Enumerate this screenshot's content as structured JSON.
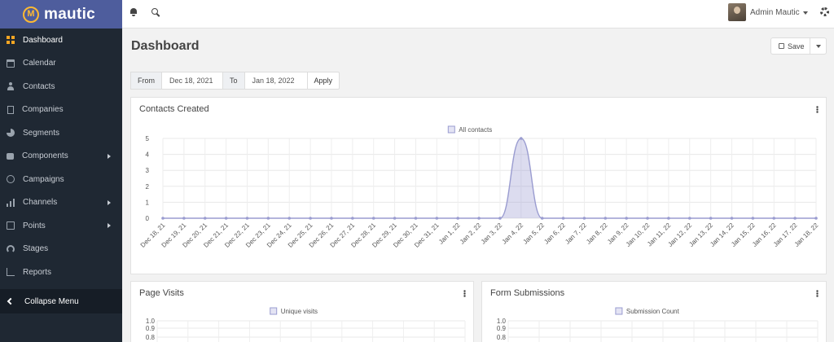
{
  "brand": {
    "name": "mautic",
    "logo_letter": "M"
  },
  "sidebar": {
    "items": [
      {
        "label": "Dashboard",
        "icon": "dashboard-icon",
        "active": true
      },
      {
        "label": "Calendar",
        "icon": "calendar-icon"
      },
      {
        "label": "Contacts",
        "icon": "user-icon"
      },
      {
        "label": "Companies",
        "icon": "building-icon"
      },
      {
        "label": "Segments",
        "icon": "pie-icon"
      },
      {
        "label": "Components",
        "icon": "puzzle-icon",
        "submenu": true
      },
      {
        "label": "Campaigns",
        "icon": "clock-icon"
      },
      {
        "label": "Channels",
        "icon": "signal-icon",
        "submenu": true
      },
      {
        "label": "Points",
        "icon": "calculator-icon",
        "submenu": true
      },
      {
        "label": "Stages",
        "icon": "gauge-icon"
      },
      {
        "label": "Reports",
        "icon": "line-chart-icon"
      }
    ],
    "collapse_label": "Collapse Menu"
  },
  "topbar": {
    "user_name": "Admin Mautic"
  },
  "page": {
    "title": "Dashboard",
    "save_label": "Save"
  },
  "date_range": {
    "from_label": "From",
    "from_value": "Dec 18, 2021",
    "to_label": "To",
    "to_value": "Jan 18, 2022",
    "apply_label": "Apply"
  },
  "colors": {
    "brand": "#4e5d9d",
    "sidebar": "#1f2833",
    "accent": "#f5a623",
    "series": "#9a9cd0"
  },
  "chart_data": [
    {
      "type": "area",
      "title": "Contacts Created",
      "categories": [
        "Dec 18, 21",
        "Dec 19, 21",
        "Dec 20, 21",
        "Dec 21, 21",
        "Dec 22, 21",
        "Dec 23, 21",
        "Dec 24, 21",
        "Dec 25, 21",
        "Dec 26, 21",
        "Dec 27, 21",
        "Dec 28, 21",
        "Dec 29, 21",
        "Dec 30, 21",
        "Dec 31, 21",
        "Jan 1, 22",
        "Jan 2, 22",
        "Jan 3, 22",
        "Jan 4, 22",
        "Jan 5, 22",
        "Jan 6, 22",
        "Jan 7, 22",
        "Jan 8, 22",
        "Jan 9, 22",
        "Jan 10, 22",
        "Jan 11, 22",
        "Jan 12, 22",
        "Jan 13, 22",
        "Jan 14, 22",
        "Jan 15, 22",
        "Jan 16, 22",
        "Jan 17, 22",
        "Jan 18, 22"
      ],
      "series": [
        {
          "name": "All contacts",
          "values": [
            0,
            0,
            0,
            0,
            0,
            0,
            0,
            0,
            0,
            0,
            0,
            0,
            0,
            0,
            0,
            0,
            0,
            5,
            0,
            0,
            0,
            0,
            0,
            0,
            0,
            0,
            0,
            0,
            0,
            0,
            0,
            0
          ]
        }
      ],
      "yticks": [
        "0",
        "1",
        "2",
        "3",
        "4",
        "5"
      ],
      "ylim": [
        0,
        5
      ],
      "grid": true,
      "legend": "top-center"
    },
    {
      "type": "line",
      "title": "Page Visits",
      "series": [
        {
          "name": "Unique visits",
          "values": []
        }
      ],
      "yticks": [
        "0.8",
        "0.9",
        "1.0"
      ],
      "legend": "top-center"
    },
    {
      "type": "line",
      "title": "Form Submissions",
      "series": [
        {
          "name": "Submission Count",
          "values": []
        }
      ],
      "yticks": [
        "0.8",
        "0.9",
        "1.0"
      ],
      "legend": "top-center"
    }
  ]
}
